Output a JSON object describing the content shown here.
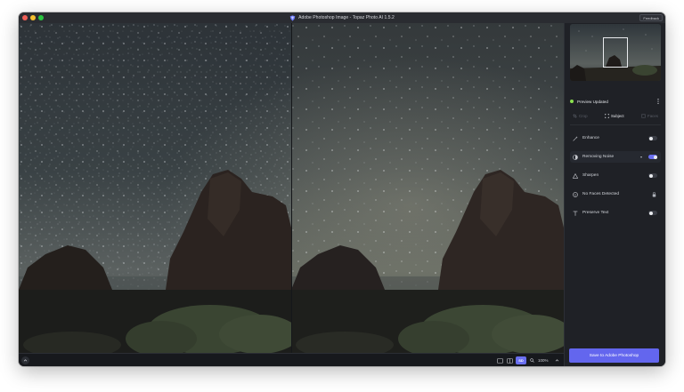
{
  "window": {
    "title": "Adobe Photoshop Image - Topaz Photo AI 1.5.2",
    "feedback_label": "Feedback"
  },
  "sidebar": {
    "preview_status": "Preview Updated",
    "modes": [
      {
        "label": "Crop",
        "active": false,
        "icon": "crop-icon"
      },
      {
        "label": "Subject",
        "active": true,
        "icon": "subject-frame-icon"
      },
      {
        "label": "Faces",
        "active": false,
        "icon": "face-icon"
      }
    ],
    "models": [
      {
        "label": "Enhance",
        "icon": "enhance-wand-icon",
        "toggle": false
      },
      {
        "label": "Removing Noise",
        "icon": "noise-icon",
        "toggle": true,
        "active": true
      },
      {
        "label": "Sharpen",
        "icon": "sharpen-triangle-icon",
        "toggle": false
      },
      {
        "label": "No Faces Detected",
        "icon": "face-icon",
        "locked": true
      },
      {
        "label": "Preserve Text",
        "icon": "text-icon",
        "toggle": false
      }
    ],
    "save_label": "Save to Adobe Photoshop"
  },
  "bottombar": {
    "view_mode_label": "SD",
    "zoom": "100%"
  },
  "colors": {
    "accent": "#6366ee",
    "status_green": "#8be14f",
    "background": "#1d1f24"
  }
}
